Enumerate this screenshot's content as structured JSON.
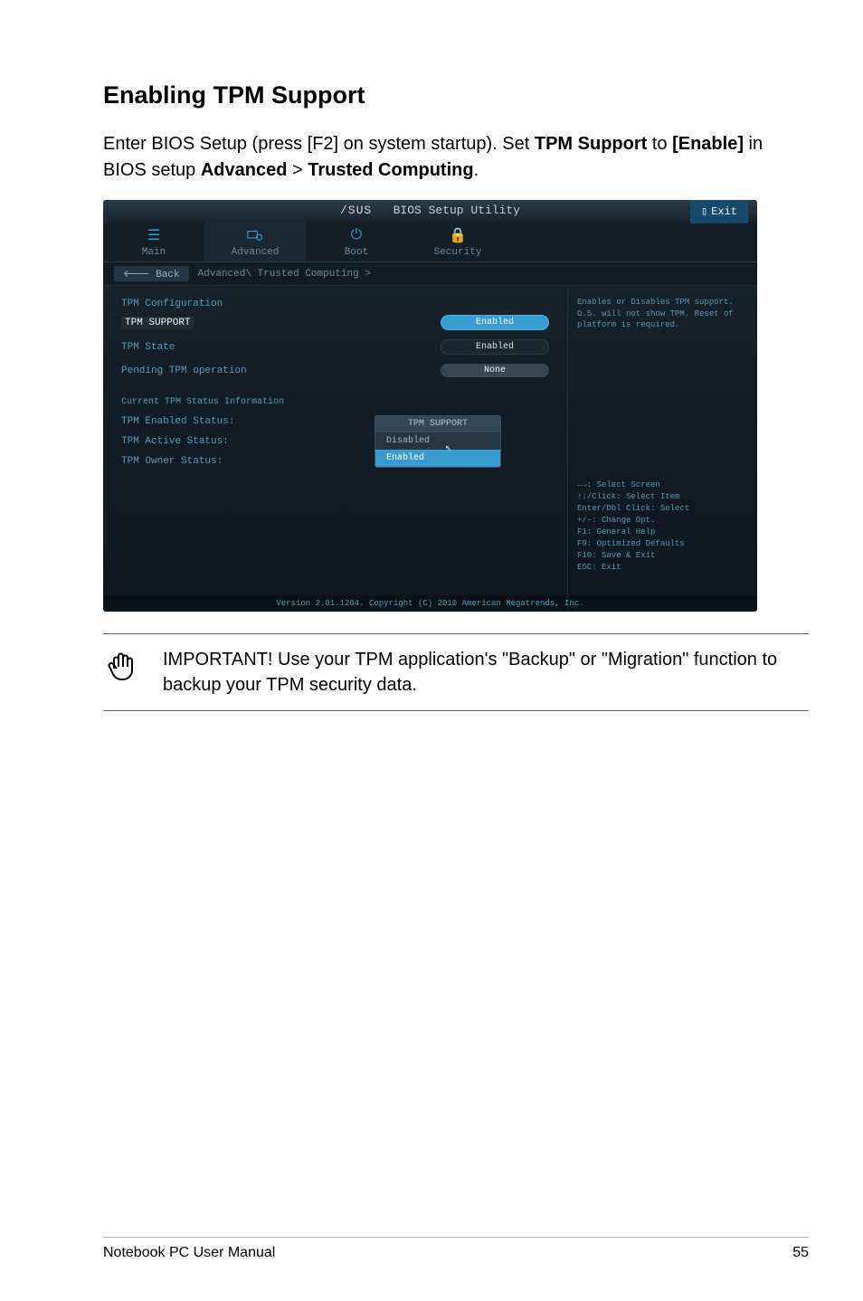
{
  "page": {
    "title": "Enabling TPM Support",
    "intro_part1": "Enter BIOS Setup (press [F2] on system startup). Set ",
    "intro_bold1": "TPM Support",
    "intro_part2": " to ",
    "intro_bold2": "[Enable]",
    "intro_part3": " in BIOS setup ",
    "intro_bold3": "Advanced",
    "intro_part4": " > ",
    "intro_bold4": "Trusted Computing",
    "intro_part5": "."
  },
  "bios": {
    "header_brand": "/SUS",
    "header_title": "BIOS Setup Utility",
    "exit_label": "Exit",
    "tabs": {
      "main": "Main",
      "advanced": "Advanced",
      "boot": "Boot",
      "security": "Security"
    },
    "breadcrumb": {
      "back": "Back",
      "path": "Advanced\\ Trusted Computing >"
    },
    "config_header": "TPM Configuration",
    "tpm_support_label": "TPM SUPPORT",
    "tpm_support_value": "Enabled",
    "tpm_state_label": "TPM State",
    "tpm_state_value": "Enabled",
    "pending_op_label": "Pending TPM operation",
    "pending_op_value": "None",
    "status_header": "Current TPM Status Information",
    "tpm_enabled_status_label": "TPM Enabled Status:",
    "tpm_active_status_label": "TPM Active Status:",
    "tpm_owner_status_label": "TPM Owner Status:",
    "dropdown_title": "TPM SUPPORT",
    "dropdown_opt1": "Disabled",
    "dropdown_opt2": "Enabled",
    "help_text": "Enables or Disables TPM support. O.S. will not show TPM. Reset of platform is required.",
    "keyhelp": {
      "l1": "←→: Select Screen",
      "l2": "↑↓/Click: Select Item",
      "l3": "Enter/Dbl Click: Select",
      "l4": "+/-: Change Opt.",
      "l5": "F1: General Help",
      "l6": "F9: Optimized Defaults",
      "l7": "F10: Save & Exit",
      "l8": "ESC: Exit"
    },
    "footer": "Version 2.01.1204. Copyright (C) 2010 American Megatrends, Inc."
  },
  "note": {
    "text": "IMPORTANT! Use your TPM application's \"Backup\" or \"Migration\" function to backup your TPM security data."
  },
  "footer": {
    "left": "Notebook PC User Manual",
    "right": "55"
  }
}
